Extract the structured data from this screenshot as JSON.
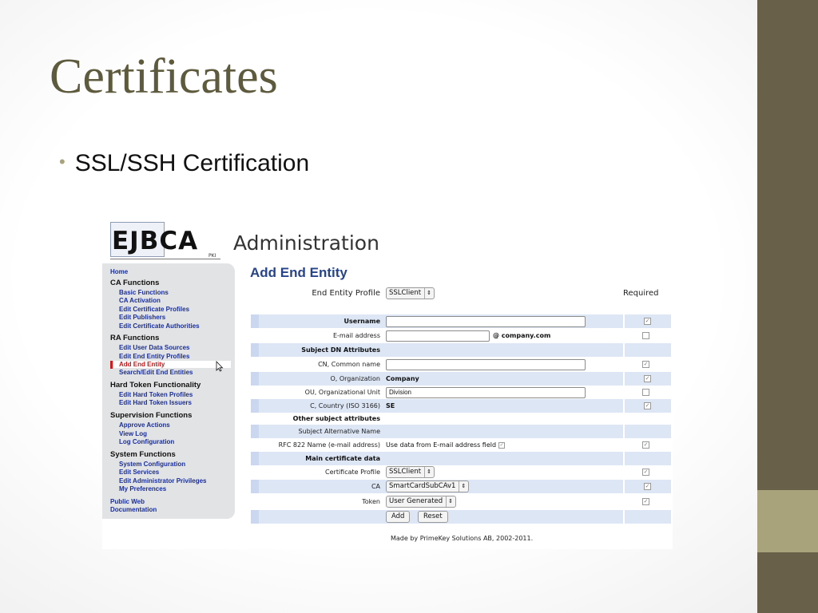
{
  "slide": {
    "title": "Certificates",
    "bullet": "SSL/SSH Certification",
    "bullet_glyph": "•",
    "colors": {
      "band": "#686048",
      "accent": "#a8a37a",
      "title": "#5d5a3e"
    }
  },
  "app": {
    "logo": "EJBCA",
    "logo_sub": "PKI",
    "header": "Administration"
  },
  "menu": {
    "home": "Home",
    "ca_head": "CA Functions",
    "ca_items": [
      "Basic Functions",
      "CA Activation",
      "Edit Certificate Profiles",
      "Edit Publishers",
      "Edit Certificate Authorities"
    ],
    "ra_head": "RA Functions",
    "ra_items": [
      "Edit User Data Sources",
      "Edit End Entity Profiles",
      "Add End Entity",
      "Search/Edit End Entities"
    ],
    "ht_head": "Hard Token Functionality",
    "ht_items": [
      "Edit Hard Token Profiles",
      "Edit Hard Token Issuers"
    ],
    "sup_head": "Supervision Functions",
    "sup_items": [
      "Approve Actions",
      "View Log",
      "Log Configuration"
    ],
    "sys_head": "System Functions",
    "sys_items": [
      "System Configuration",
      "Edit Services",
      "Edit Administrator Privileges",
      "My Preferences"
    ],
    "public_web": "Public Web",
    "documentation": "Documentation",
    "active_color": "#c0181b",
    "link_color": "#1a2f9c"
  },
  "form": {
    "title": "Add End Entity",
    "profile_label": "End Entity Profile",
    "profile_value": "SSLClient",
    "required_label": "Required",
    "check_glyph": "✓",
    "select_arrow": "⇕",
    "username_label": "Username",
    "username_value": "",
    "email_label": "E-mail address",
    "email_value": "",
    "email_domain": "@ company.com",
    "subject_dn_header": "Subject DN Attributes",
    "cn_label": "CN, Common name",
    "cn_value": "",
    "o_label": "O, Organization",
    "o_value": "Company",
    "ou_label": "OU, Organizational Unit",
    "ou_value": "Division",
    "c_label": "C, Country (ISO 3166)",
    "c_value": "SE",
    "other_header": "Other subject attributes",
    "san_header": "Subject Alternative Name",
    "rfc_label": "RFC 822 Name (e-mail address)",
    "rfc_value": "Use data from E-mail address field",
    "main_header": "Main certificate data",
    "cert_profile_label": "Certificate Profile",
    "cert_profile_value": "SSLClient",
    "ca_label": "CA",
    "ca_value": "SmartCardSubCAv1",
    "token_label": "Token",
    "token_value": "User Generated",
    "add_button": "Add",
    "reset_button": "Reset"
  },
  "footer": "Made by PrimeKey Solutions AB, 2002-2011."
}
